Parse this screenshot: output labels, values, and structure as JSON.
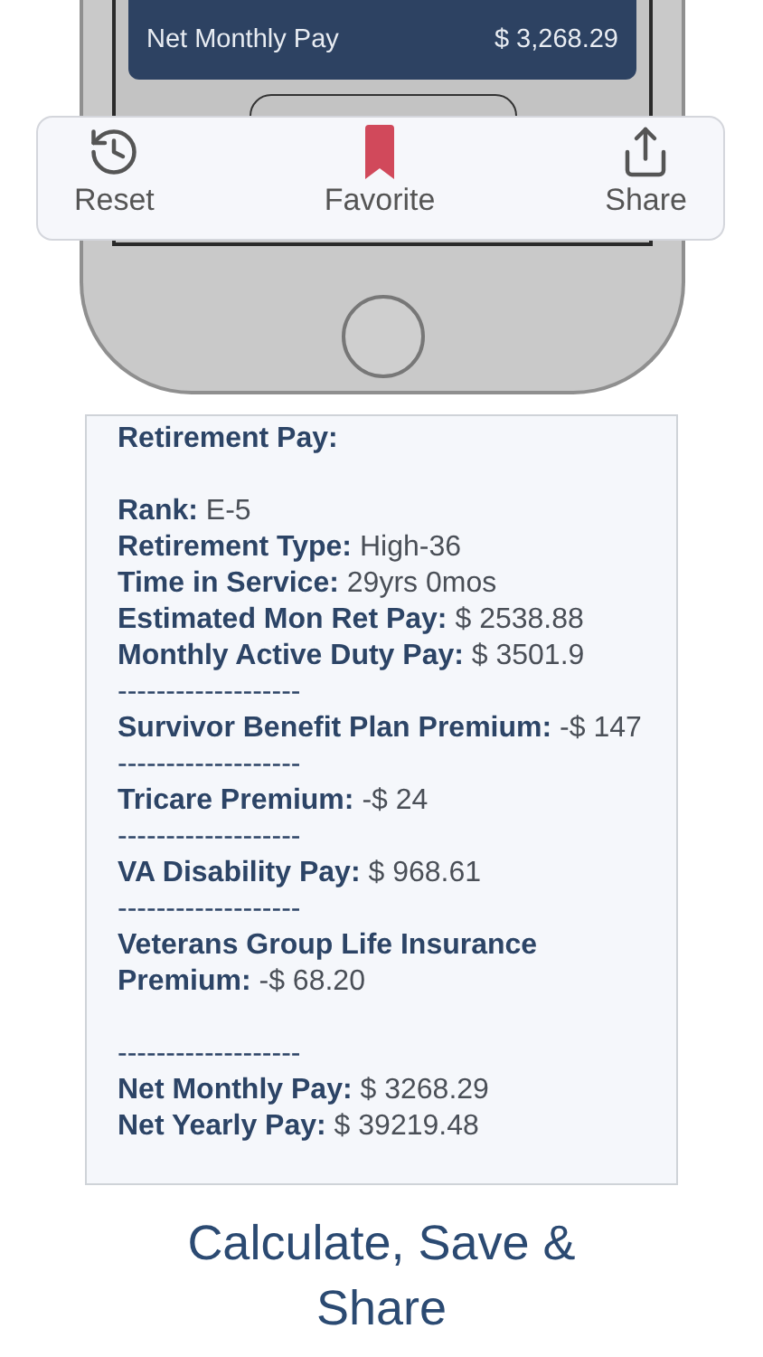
{
  "phone_screen": {
    "summary_card": {
      "label": "Net Monthly Pay",
      "value": "$ 3,268.29"
    }
  },
  "action_sheet": {
    "actions": [
      {
        "label": "Reset",
        "kind": "reset"
      },
      {
        "label": "Favorite",
        "kind": "favorite"
      },
      {
        "label": "Share",
        "kind": "share"
      }
    ]
  },
  "report": {
    "lines": [
      {
        "kind": "heading",
        "label": "Retirement Pay:"
      },
      {
        "kind": "blank"
      },
      {
        "kind": "field",
        "label": "Rank:",
        "value": "E-5"
      },
      {
        "kind": "field",
        "label": "Retirement Type:",
        "value": "High-36"
      },
      {
        "kind": "field",
        "label": "Time in Service:",
        "value": "29yrs 0mos"
      },
      {
        "kind": "field",
        "label": "Estimated Mon Ret Pay:",
        "value": "$ 2538.88"
      },
      {
        "kind": "field",
        "label": "Monthly Active Duty Pay:",
        "value": "$ 3501.9"
      },
      {
        "kind": "divider",
        "text": "-------------------"
      },
      {
        "kind": "field",
        "label": "Survivor Benefit Plan Premium:",
        "value": "-$ 147"
      },
      {
        "kind": "divider",
        "text": "-------------------"
      },
      {
        "kind": "field",
        "label": "Tricare Premium:",
        "value": "-$ 24"
      },
      {
        "kind": "divider",
        "text": "-------------------"
      },
      {
        "kind": "field",
        "label": "VA Disability Pay:",
        "value": "$ 968.61"
      },
      {
        "kind": "divider",
        "text": "-------------------"
      },
      {
        "kind": "field",
        "label": "Veterans Group Life Insurance Premium:",
        "value": "-$ 68.20"
      },
      {
        "kind": "blank"
      },
      {
        "kind": "divider",
        "text": "-------------------"
      },
      {
        "kind": "field",
        "label": "Net Monthly Pay:",
        "value": "$ 3268.29"
      },
      {
        "kind": "field",
        "label": "Net Yearly Pay:",
        "value": "$ 39219.48"
      }
    ]
  },
  "caption": "Calculate, Save & Share"
}
